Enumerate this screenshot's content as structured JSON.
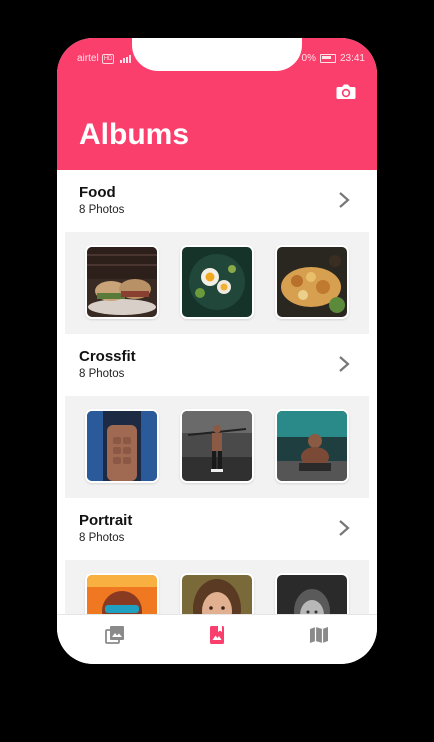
{
  "status_bar": {
    "carrier": "airtel",
    "network": "HD",
    "battery": "0%",
    "time": "23:41"
  },
  "header": {
    "title": "Albums",
    "camera_icon": "camera-icon",
    "background": "#fb3f6c"
  },
  "albums": [
    {
      "name": "Food",
      "count": "8 Photos",
      "thumbs": [
        "burger-photo",
        "salad-photo",
        "platter-photo"
      ]
    },
    {
      "name": "Crossfit",
      "count": "8 Photos",
      "thumbs": [
        "abs-photo",
        "gym-photo",
        "athlete-photo"
      ]
    },
    {
      "name": "Portrait",
      "count": "8 Photos",
      "thumbs": [
        "man-photo",
        "woman-photo",
        "bw-portrait-photo"
      ]
    }
  ],
  "bottom_nav": [
    {
      "icon": "photos-icon",
      "active": false
    },
    {
      "icon": "albums-icon",
      "active": true
    },
    {
      "icon": "map-icon",
      "active": false
    }
  ],
  "colors": {
    "accent": "#fb3f6c",
    "inactive_icon": "#8a8a8a"
  }
}
